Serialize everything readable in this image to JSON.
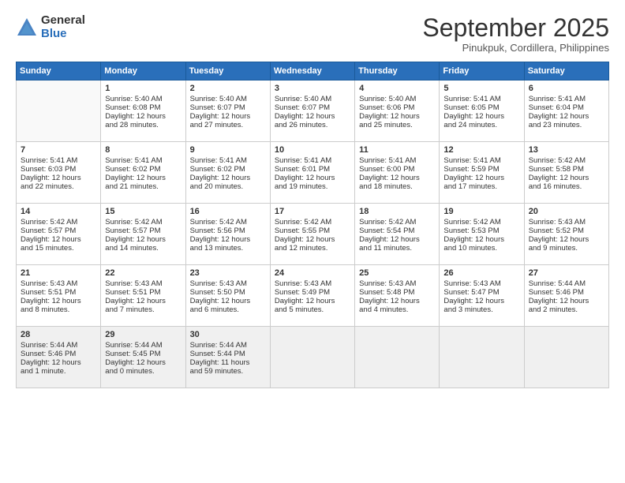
{
  "header": {
    "logo_general": "General",
    "logo_blue": "Blue",
    "month_title": "September 2025",
    "location": "Pinukpuk, Cordillera, Philippines"
  },
  "calendar": {
    "weekdays": [
      "Sunday",
      "Monday",
      "Tuesday",
      "Wednesday",
      "Thursday",
      "Friday",
      "Saturday"
    ],
    "weeks": [
      [
        {
          "day": "",
          "content": ""
        },
        {
          "day": "1",
          "content": "Sunrise: 5:40 AM\nSunset: 6:08 PM\nDaylight: 12 hours\nand 28 minutes."
        },
        {
          "day": "2",
          "content": "Sunrise: 5:40 AM\nSunset: 6:07 PM\nDaylight: 12 hours\nand 27 minutes."
        },
        {
          "day": "3",
          "content": "Sunrise: 5:40 AM\nSunset: 6:07 PM\nDaylight: 12 hours\nand 26 minutes."
        },
        {
          "day": "4",
          "content": "Sunrise: 5:40 AM\nSunset: 6:06 PM\nDaylight: 12 hours\nand 25 minutes."
        },
        {
          "day": "5",
          "content": "Sunrise: 5:41 AM\nSunset: 6:05 PM\nDaylight: 12 hours\nand 24 minutes."
        },
        {
          "day": "6",
          "content": "Sunrise: 5:41 AM\nSunset: 6:04 PM\nDaylight: 12 hours\nand 23 minutes."
        }
      ],
      [
        {
          "day": "7",
          "content": "Sunrise: 5:41 AM\nSunset: 6:03 PM\nDaylight: 12 hours\nand 22 minutes."
        },
        {
          "day": "8",
          "content": "Sunrise: 5:41 AM\nSunset: 6:02 PM\nDaylight: 12 hours\nand 21 minutes."
        },
        {
          "day": "9",
          "content": "Sunrise: 5:41 AM\nSunset: 6:02 PM\nDaylight: 12 hours\nand 20 minutes."
        },
        {
          "day": "10",
          "content": "Sunrise: 5:41 AM\nSunset: 6:01 PM\nDaylight: 12 hours\nand 19 minutes."
        },
        {
          "day": "11",
          "content": "Sunrise: 5:41 AM\nSunset: 6:00 PM\nDaylight: 12 hours\nand 18 minutes."
        },
        {
          "day": "12",
          "content": "Sunrise: 5:41 AM\nSunset: 5:59 PM\nDaylight: 12 hours\nand 17 minutes."
        },
        {
          "day": "13",
          "content": "Sunrise: 5:42 AM\nSunset: 5:58 PM\nDaylight: 12 hours\nand 16 minutes."
        }
      ],
      [
        {
          "day": "14",
          "content": "Sunrise: 5:42 AM\nSunset: 5:57 PM\nDaylight: 12 hours\nand 15 minutes."
        },
        {
          "day": "15",
          "content": "Sunrise: 5:42 AM\nSunset: 5:57 PM\nDaylight: 12 hours\nand 14 minutes."
        },
        {
          "day": "16",
          "content": "Sunrise: 5:42 AM\nSunset: 5:56 PM\nDaylight: 12 hours\nand 13 minutes."
        },
        {
          "day": "17",
          "content": "Sunrise: 5:42 AM\nSunset: 5:55 PM\nDaylight: 12 hours\nand 12 minutes."
        },
        {
          "day": "18",
          "content": "Sunrise: 5:42 AM\nSunset: 5:54 PM\nDaylight: 12 hours\nand 11 minutes."
        },
        {
          "day": "19",
          "content": "Sunrise: 5:42 AM\nSunset: 5:53 PM\nDaylight: 12 hours\nand 10 minutes."
        },
        {
          "day": "20",
          "content": "Sunrise: 5:43 AM\nSunset: 5:52 PM\nDaylight: 12 hours\nand 9 minutes."
        }
      ],
      [
        {
          "day": "21",
          "content": "Sunrise: 5:43 AM\nSunset: 5:51 PM\nDaylight: 12 hours\nand 8 minutes."
        },
        {
          "day": "22",
          "content": "Sunrise: 5:43 AM\nSunset: 5:51 PM\nDaylight: 12 hours\nand 7 minutes."
        },
        {
          "day": "23",
          "content": "Sunrise: 5:43 AM\nSunset: 5:50 PM\nDaylight: 12 hours\nand 6 minutes."
        },
        {
          "day": "24",
          "content": "Sunrise: 5:43 AM\nSunset: 5:49 PM\nDaylight: 12 hours\nand 5 minutes."
        },
        {
          "day": "25",
          "content": "Sunrise: 5:43 AM\nSunset: 5:48 PM\nDaylight: 12 hours\nand 4 minutes."
        },
        {
          "day": "26",
          "content": "Sunrise: 5:43 AM\nSunset: 5:47 PM\nDaylight: 12 hours\nand 3 minutes."
        },
        {
          "day": "27",
          "content": "Sunrise: 5:44 AM\nSunset: 5:46 PM\nDaylight: 12 hours\nand 2 minutes."
        }
      ],
      [
        {
          "day": "28",
          "content": "Sunrise: 5:44 AM\nSunset: 5:46 PM\nDaylight: 12 hours\nand 1 minute."
        },
        {
          "day": "29",
          "content": "Sunrise: 5:44 AM\nSunset: 5:45 PM\nDaylight: 12 hours\nand 0 minutes."
        },
        {
          "day": "30",
          "content": "Sunrise: 5:44 AM\nSunset: 5:44 PM\nDaylight: 11 hours\nand 59 minutes."
        },
        {
          "day": "",
          "content": ""
        },
        {
          "day": "",
          "content": ""
        },
        {
          "day": "",
          "content": ""
        },
        {
          "day": "",
          "content": ""
        }
      ]
    ]
  }
}
